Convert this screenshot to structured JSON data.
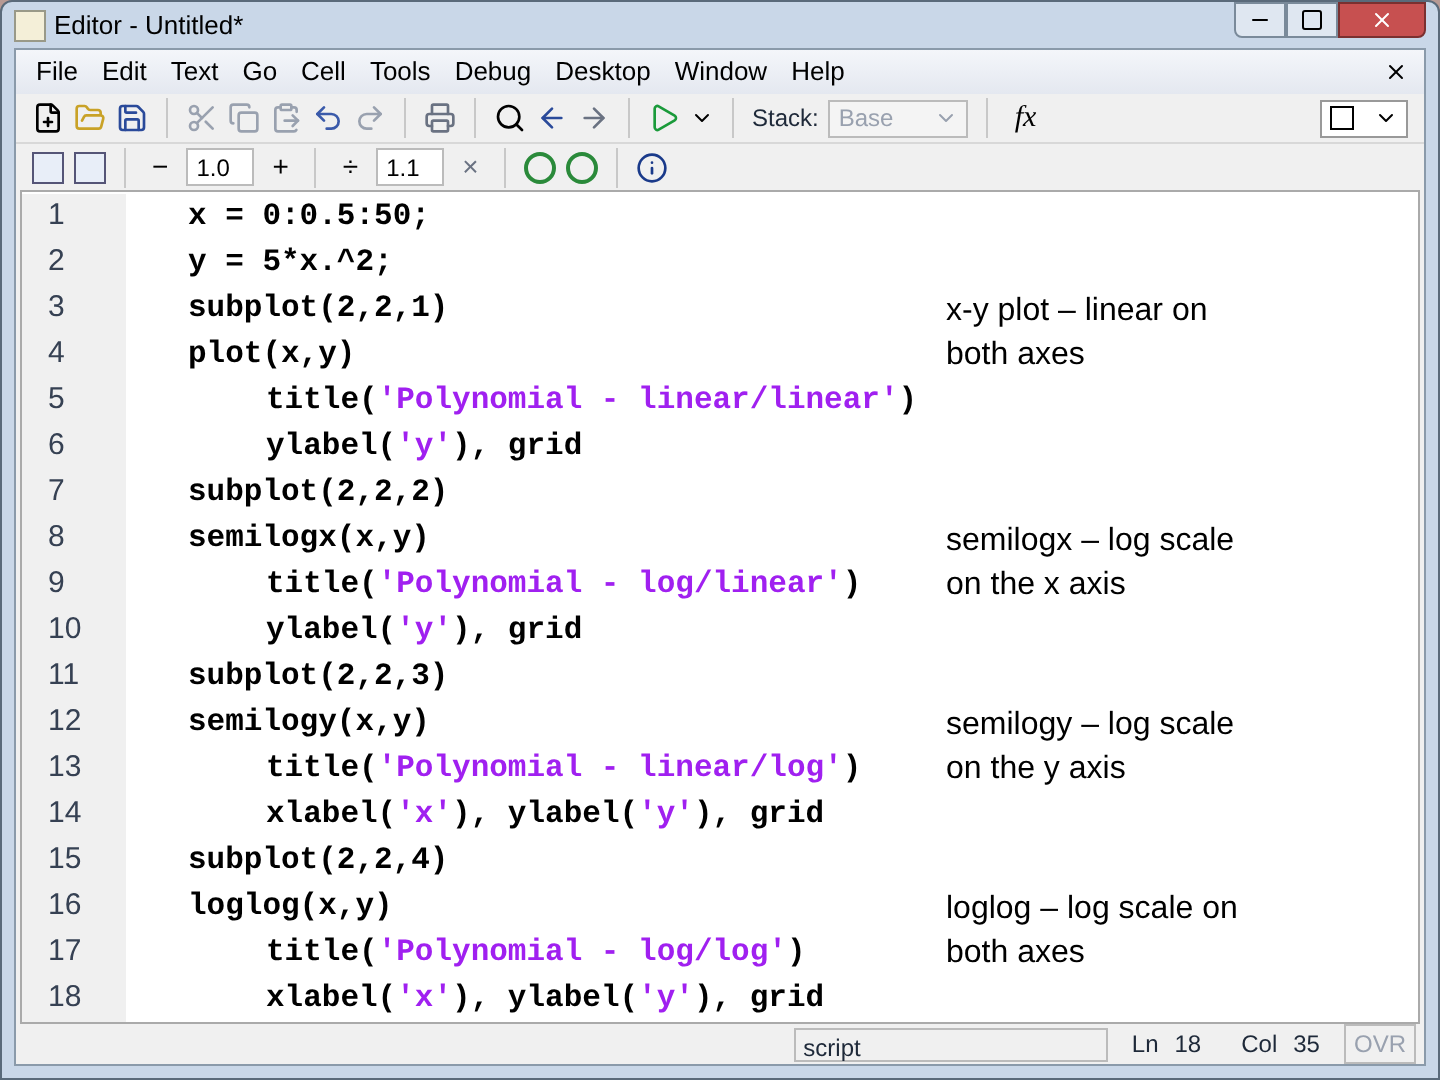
{
  "window": {
    "title": "Editor - Untitled*"
  },
  "menu": [
    "File",
    "Edit",
    "Text",
    "Go",
    "Cell",
    "Tools",
    "Debug",
    "Desktop",
    "Window",
    "Help"
  ],
  "toolbar": {
    "stack_label": "Stack:",
    "stack_value": "Base",
    "fx": "fx"
  },
  "cell_toolbar": {
    "minus": "−",
    "decrement": "1.0",
    "plus": "+",
    "divide": "÷",
    "factor": "1.1",
    "times": "×"
  },
  "lines": [
    {
      "number": "1",
      "indent": false,
      "parts": [
        {
          "kind": "code",
          "text": "x = 0:0.5:50;"
        }
      ]
    },
    {
      "number": "2",
      "indent": false,
      "parts": [
        {
          "kind": "code",
          "text": "y = 5*x.^2;"
        }
      ]
    },
    {
      "number": "3",
      "indent": false,
      "parts": [
        {
          "kind": "code",
          "text": "subplot(2,2,1)"
        }
      ],
      "note": "x-y plot – linear on both axes"
    },
    {
      "number": "4",
      "indent": false,
      "parts": [
        {
          "kind": "code",
          "text": "plot(x,y)"
        }
      ]
    },
    {
      "number": "5",
      "indent": true,
      "parts": [
        {
          "kind": "code",
          "text": "title("
        },
        {
          "kind": "string",
          "text": "'Polynomial - linear/linear'"
        },
        {
          "kind": "code",
          "text": ")"
        }
      ]
    },
    {
      "number": "6",
      "indent": true,
      "parts": [
        {
          "kind": "code",
          "text": "ylabel("
        },
        {
          "kind": "string",
          "text": "'y'"
        },
        {
          "kind": "code",
          "text": "), grid"
        }
      ]
    },
    {
      "number": "7",
      "indent": false,
      "parts": [
        {
          "kind": "code",
          "text": "subplot(2,2,2)"
        }
      ]
    },
    {
      "number": "8",
      "indent": false,
      "parts": [
        {
          "kind": "code",
          "text": "semilogx(x,y)"
        }
      ],
      "note": "semilogx – log scale on the x axis"
    },
    {
      "number": "9",
      "indent": true,
      "parts": [
        {
          "kind": "code",
          "text": "title("
        },
        {
          "kind": "string",
          "text": "'Polynomial - log/linear'"
        },
        {
          "kind": "code",
          "text": ")"
        }
      ]
    },
    {
      "number": "10",
      "indent": true,
      "parts": [
        {
          "kind": "code",
          "text": "ylabel("
        },
        {
          "kind": "string",
          "text": "'y'"
        },
        {
          "kind": "code",
          "text": "), grid"
        }
      ]
    },
    {
      "number": "11",
      "indent": false,
      "parts": [
        {
          "kind": "code",
          "text": "subplot(2,2,3)"
        }
      ]
    },
    {
      "number": "12",
      "indent": false,
      "parts": [
        {
          "kind": "code",
          "text": "semilogy(x,y)"
        }
      ],
      "note": "semilogy – log scale on the y axis"
    },
    {
      "number": "13",
      "indent": true,
      "parts": [
        {
          "kind": "code",
          "text": "title("
        },
        {
          "kind": "string",
          "text": "'Polynomial - linear/log'"
        },
        {
          "kind": "code",
          "text": ")"
        }
      ]
    },
    {
      "number": "14",
      "indent": true,
      "parts": [
        {
          "kind": "code",
          "text": "xlabel("
        },
        {
          "kind": "string",
          "text": "'x'"
        },
        {
          "kind": "code",
          "text": "), ylabel("
        },
        {
          "kind": "string",
          "text": "'y'"
        },
        {
          "kind": "code",
          "text": "), grid"
        }
      ]
    },
    {
      "number": "15",
      "indent": false,
      "parts": [
        {
          "kind": "code",
          "text": "subplot(2,2,4)"
        }
      ]
    },
    {
      "number": "16",
      "indent": false,
      "parts": [
        {
          "kind": "code",
          "text": "loglog(x,y)"
        }
      ],
      "note": "loglog – log scale on both axes"
    },
    {
      "number": "17",
      "indent": true,
      "parts": [
        {
          "kind": "code",
          "text": "title("
        },
        {
          "kind": "string",
          "text": "'Polynomial - log/log'"
        },
        {
          "kind": "code",
          "text": ")"
        }
      ]
    },
    {
      "number": "18",
      "indent": true,
      "parts": [
        {
          "kind": "code",
          "text": "xlabel("
        },
        {
          "kind": "string",
          "text": "'x'"
        },
        {
          "kind": "code",
          "text": "), ylabel("
        },
        {
          "kind": "string",
          "text": "'y'"
        },
        {
          "kind": "code",
          "text": "), grid"
        }
      ]
    }
  ],
  "status_bar": {
    "mode": "script",
    "ln_label": "Ln",
    "ln": "18",
    "col_label": "Col",
    "col": "35",
    "ovr": "OVR"
  }
}
